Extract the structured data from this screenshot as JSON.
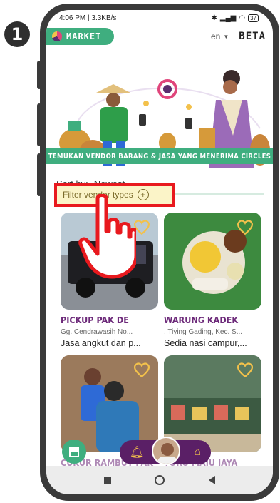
{
  "step_number": "1",
  "status": {
    "time_speed": "4:06 PM | 3.3KB/s",
    "battery": "37"
  },
  "header": {
    "brand": "MARKET",
    "lang": "en",
    "beta": "BETA"
  },
  "hero": {
    "banner": "TEMUKAN VENDOR BARANG & JASA YANG MENERIMA CIRCLES"
  },
  "sort": {
    "label": "Sort by:",
    "value": "Newest"
  },
  "filter": {
    "label": "Filter vendor types"
  },
  "vendors": [
    {
      "name": "PICKUP PAK DE",
      "address": "Gg. Cendrawasih No...",
      "desc": "Jasa angkut dan p..."
    },
    {
      "name": "WARUNG KADEK",
      "address": ", Tiying Gading, Kec. S...",
      "desc": "Sedia nasi campur,..."
    },
    {
      "name": "CUKUR RAMBUT PAK",
      "address": "",
      "desc": ""
    },
    {
      "name": "TOKO MAJU JAYA",
      "address": "",
      "desc": ""
    }
  ],
  "colors": {
    "brand_green": "#3fae7f",
    "vendor_name": "#6d2a7a",
    "nav_pill": "#5a1f66",
    "highlight_border": "#e8191e"
  }
}
